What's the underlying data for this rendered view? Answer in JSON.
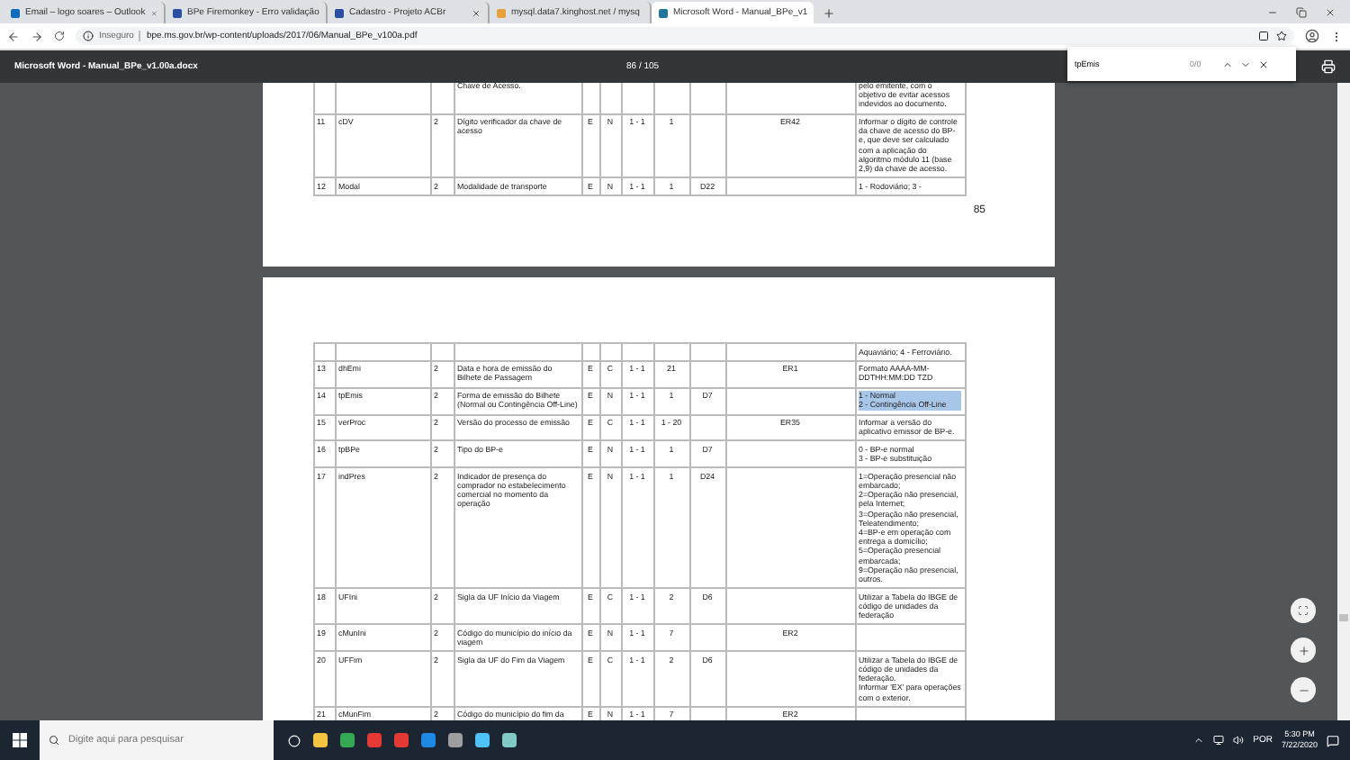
{
  "browser": {
    "tabs": [
      {
        "title": "Email – logo soares – Outlook",
        "selected": false
      },
      {
        "title": "BPe Firemonkey - Erro validação",
        "selected": false
      },
      {
        "title": "Cadastro - Projeto ACBr",
        "selected": false
      },
      {
        "title": "mysql.data7.kinghost.net / mysq",
        "selected": false
      },
      {
        "title": "Microsoft Word - Manual_BPe_v1",
        "selected": true
      }
    ],
    "security": "Inseguro",
    "url": "bpe.ms.gov.br/wp-content/uploads/2017/06/Manual_BPe_v100a.pdf"
  },
  "viewer": {
    "title": "Microsoft Word - Manual_BPe_v1.00a.docx",
    "page_indicator": "86 / 105"
  },
  "find_bar": {
    "query": "tpEmis",
    "count": "0/0"
  },
  "page_1": {
    "page_number": "85",
    "rows": [
      {
        "cells": [
          null,
          null,
          null,
          "Chave de Acesso.",
          null,
          null,
          null,
          null,
          null,
          null
        ],
        "note": [
          "pelo emitente, com o objetivo de evitar acessos indevidos ao documento."
        ]
      },
      {
        "cells": [
          "11",
          "cDV",
          "2",
          "Dígito verificador da chave de acesso",
          "E",
          "N",
          "1 - 1",
          "1",
          null,
          "ER42"
        ],
        "note": [
          "Informar o dígito de controle da chave de acesso do BP-e, que deve ser calculado com a aplicação do algoritmo módulo 11 (base 2,9) da chave de acesso."
        ]
      },
      {
        "cells": [
          "12",
          "Modal",
          "2",
          "Modalidade de transporte",
          "E",
          "N",
          "1 - 1",
          "1",
          "D22",
          null
        ],
        "note": [
          "1 - Rodoviário; 3 -"
        ]
      }
    ]
  },
  "page_2": {
    "rows": [
      {
        "cells": [
          null,
          null,
          null,
          null,
          null,
          null,
          null,
          null,
          null,
          null
        ],
        "note": [
          "Aquaviário; 4 - Ferroviário."
        ]
      },
      {
        "cells": [
          "13",
          "dhEmi",
          "2",
          "Data e hora de emissão do Bilhete de Passagem",
          "E",
          "C",
          "1 - 1",
          "21",
          null,
          "ER1"
        ],
        "note": [
          "Formato AAAA-MM-DDTHH:MM:DD TZD"
        ]
      },
      {
        "cells": [
          "14",
          "tpEmis",
          "2",
          "Forma de emissão do Bilhete (Normal ou Contingência Off-Line)",
          "E",
          "N",
          "1 - 1",
          "1",
          "D7",
          null
        ],
        "note": [
          "1 - Normal",
          "2 - Contingência Off-Line"
        ],
        "note_highlighted": true
      },
      {
        "cells": [
          "15",
          "verProc",
          "2",
          "Versão do processo de emissão",
          "E",
          "C",
          "1 - 1",
          "1 - 20",
          null,
          "ER35"
        ],
        "note": [
          "Informar a versão do aplicativo emissor de BP-e."
        ]
      },
      {
        "cells": [
          "16",
          "tpBPe",
          "2",
          "Tipo do BP-e",
          "E",
          "N",
          "1 - 1",
          "1",
          "D7",
          null
        ],
        "note": [
          "0 - BP-e normal",
          "3 - BP-e substituição"
        ]
      },
      {
        "cells": [
          "17",
          "indPres",
          "2",
          "Indicador de presença do comprador no estabelecimento comercial no momento da operação",
          "E",
          "N",
          "1 - 1",
          "1",
          "D24",
          null
        ],
        "note": [
          "1=Operação presencial não embarcado;",
          "2=Operação não presencial, pela Internet;",
          "3=Operação não presencial, Teleatendimento;",
          "4=BP-e em operação com entrega a domicílio;",
          "5=Operação presencial embarcada;",
          "9=Operação não presencial, outros."
        ]
      },
      {
        "cells": [
          "18",
          "UFIni",
          "2",
          "Sigla da UF Início da Viagem",
          "E",
          "C",
          "1 - 1",
          "2",
          "D6",
          null
        ],
        "note": [
          "Utilizar a Tabela do IBGE de código de unidades da federação"
        ]
      },
      {
        "cells": [
          "19",
          "cMunIni",
          "2",
          "Código do município do início da viagem",
          "E",
          "N",
          "1 - 1",
          "7",
          null,
          "ER2"
        ]
      },
      {
        "cells": [
          "20",
          "UFFim",
          "2",
          "Sigla da UF do Fim da Viagem",
          "E",
          "C",
          "1 - 1",
          "2",
          "D6",
          null
        ],
        "note": [
          "Utilizar a Tabela do IBGE de código de unidades da federação.",
          "Informar 'EX' para operações com o exterior."
        ]
      },
      {
        "cells": [
          "21",
          "cMunFim",
          "2",
          "Código do município do fim da",
          "E",
          "N",
          "1 - 1",
          "7",
          null,
          "ER2"
        ]
      }
    ]
  },
  "taskbar": {
    "search_placeholder": "Digite aqui para pesquisar",
    "language": "POR",
    "time": "5:30 PM",
    "date": "7/22/2020"
  }
}
